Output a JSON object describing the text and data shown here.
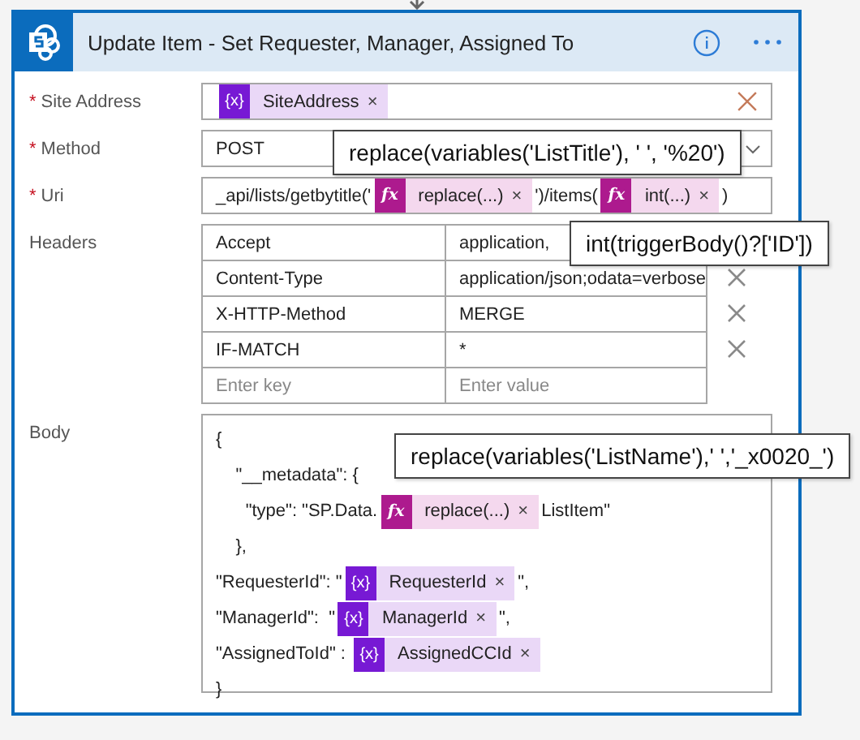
{
  "card": {
    "title": "Update Item - Set Requester, Manager, Assigned To"
  },
  "fields": [
    {
      "kind": "tokens",
      "label": "Site Address",
      "marker": "*",
      "clearable": true,
      "parts": [
        {
          "kind": "variable",
          "icon": "{x}",
          "text": "SiteAddress",
          "remove": "×"
        }
      ]
    },
    {
      "kind": "dropdown",
      "label": "Method",
      "marker": "*",
      "value": "POST"
    },
    {
      "kind": "tokens",
      "label": "Uri",
      "marker": "*",
      "clearable": false,
      "parts": [
        {
          "kind": "text",
          "text": "_api/lists/getbytitle('"
        },
        {
          "kind": "expression",
          "icon": "fx",
          "text": "replace(...)",
          "remove": "×"
        },
        {
          "kind": "text",
          "text": "')/items("
        },
        {
          "kind": "expression",
          "icon": "fx",
          "text": "int(...)",
          "remove": "×"
        },
        {
          "kind": "text",
          "text": ")"
        }
      ]
    },
    {
      "kind": "table",
      "label": "Headers",
      "rows": [
        {
          "key": "Accept",
          "value": "application,",
          "removable": false
        },
        {
          "key": "Content-Type",
          "value": "application/json;odata=verbose",
          "removable": true
        },
        {
          "key": "X-HTTP-Method",
          "value": "MERGE",
          "removable": true
        },
        {
          "key": "IF-MATCH",
          "value": "*",
          "removable": true
        }
      ],
      "new_row": {
        "key_placeholder": "Enter key",
        "value_placeholder": "Enter value"
      }
    },
    {
      "kind": "body",
      "label": "Body",
      "lines": [
        [
          {
            "kind": "text",
            "text": "{"
          }
        ],
        [
          {
            "kind": "text",
            "text": "    \"__metadata\": {"
          }
        ],
        [
          {
            "kind": "text",
            "text": "      \"type\": \"SP.Data."
          },
          {
            "kind": "expression",
            "icon": "fx",
            "text": "replace(...)",
            "remove": "×"
          },
          {
            "kind": "text",
            "text": "ListItem\""
          }
        ],
        [
          {
            "kind": "text",
            "text": "    },"
          }
        ],
        [
          {
            "kind": "text",
            "text": "\"RequesterId\": \""
          },
          {
            "kind": "variable",
            "icon": "{x}",
            "text": "RequesterId",
            "remove": "×"
          },
          {
            "kind": "text",
            "text": "\","
          }
        ],
        [
          {
            "kind": "text",
            "text": "\"ManagerId\":  \""
          },
          {
            "kind": "variable",
            "icon": "{x}",
            "text": "ManagerId",
            "remove": "×"
          },
          {
            "kind": "text",
            "text": "\","
          }
        ],
        [
          {
            "kind": "text",
            "text": "\"AssignedToId\" : "
          },
          {
            "kind": "variable",
            "icon": "{x}",
            "text": "AssignedCCId",
            "remove": "×"
          }
        ],
        [
          {
            "kind": "text",
            "text": "}"
          }
        ]
      ]
    }
  ],
  "tooltips": [
    {
      "text": "replace(variables('ListTitle'), ' ', '%20')"
    },
    {
      "text": "int(triggerBody()?['ID'])"
    },
    {
      "text": "replace(variables('ListName'),' ','_x0020_')"
    }
  ]
}
